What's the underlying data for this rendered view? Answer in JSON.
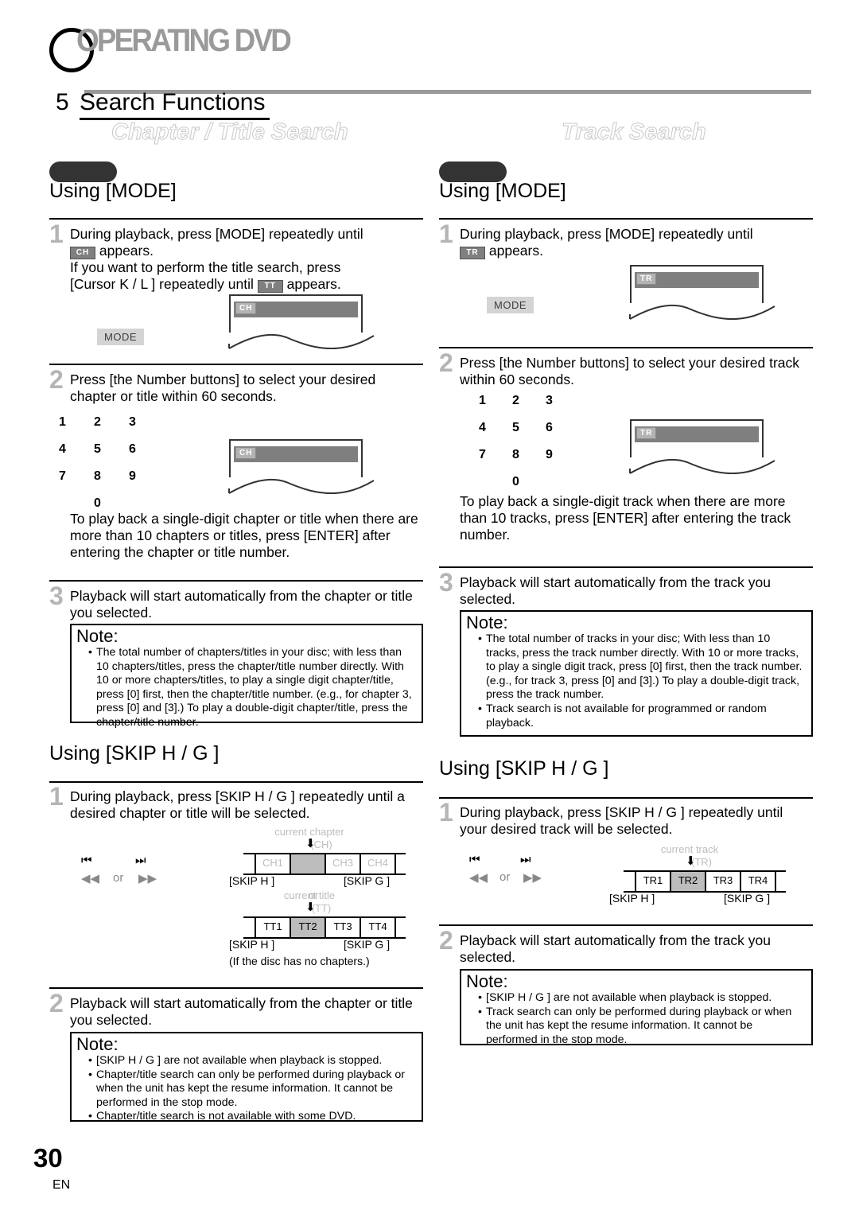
{
  "running_head": {
    "text": "OPERATING DVD",
    "drop_cap": "O"
  },
  "section": {
    "number": "5",
    "title": "Search Functions"
  },
  "columns": {
    "left": {
      "banner": "Chapter / Title Search",
      "mode_heading": "Using [MODE]",
      "skip_heading": "Using [SKIP H    / G    ]",
      "mode_steps": [
        {
          "number": "1",
          "line1": "During playback, press [MODE] repeatedly until",
          "badge1": "CH",
          "line2": "appears.",
          "line3": "If you want to perform the title search, press",
          "line4_pre": "[Cursor K / L ] repeatedly until",
          "badge2": "TT",
          "line4_post": "appears."
        },
        {
          "number": "2",
          "text": "Press [the Number buttons] to select your desired chapter or title within 60 seconds."
        },
        {
          "number": "3",
          "text": "Playback will start automatically from the chapter or title you selected."
        }
      ],
      "mode_paragraph": "To play back a single-digit chapter or title when there are more than 10 chapters or titles, press [ENTER] after entering the chapter or title number.",
      "mode_note": {
        "title": "Note:",
        "items": [
          "The total number of chapters/titles in your disc; with less than 10 chapters/titles, press the chapter/title number directly. With 10 or more chapters/titles, to play a single digit chapter/title, press [0] first, then the chapter/title number. (e.g., for chapter 3, press [0] and [3].) To play a double-digit chapter/title, press the chapter/title number."
        ]
      },
      "skip_steps": [
        {
          "number": "1",
          "text": "During playback, press [SKIP H    / G    ] repeatedly until a desired chapter or title will be selected."
        },
        {
          "number": "2",
          "text": "Playback will start automatically from the chapter or title you selected."
        }
      ],
      "skip_note": {
        "title": "Note:",
        "items": [
          "[SKIP H    / G    ] are not available when playback is stopped.",
          "Chapter/title search can only be performed during playback or when the unit has kept the resume information. It cannot be performed in the stop mode.",
          "Chapter/title search is not available with some DVD."
        ]
      },
      "panel_tag_step1": "CH",
      "panel_tag_step2": "CH",
      "mode_key_label": "MODE",
      "strip_chapter": {
        "caption_top": "current chapter",
        "caption_sub": "(CH)",
        "cells": [
          "CH1",
          "",
          "CH3",
          "CH4"
        ],
        "selected_index": 1,
        "skip_prev": "[SKIP H    ]",
        "skip_next": "[SKIP G    ]",
        "or": "or"
      },
      "strip_title": {
        "caption_top": "current title",
        "caption_sub": "(TT)",
        "cells": [
          "TT1",
          "TT2",
          "TT3",
          "TT4"
        ],
        "selected_index": 1,
        "skip_prev": "[SKIP H    ]",
        "skip_next": "[SKIP G    ]",
        "footnote": "(If the disc has no chapters.)"
      }
    },
    "right": {
      "banner": "Track Search",
      "mode_heading": "Using [MODE]",
      "skip_heading": "Using [SKIP H    / G    ]",
      "mode_steps": [
        {
          "number": "1",
          "line1": "During playback, press [MODE] repeatedly until",
          "badge1": "TR",
          "line2": "appears."
        },
        {
          "number": "2",
          "text": "Press [the Number buttons] to select your desired track within 60 seconds."
        },
        {
          "number": "3",
          "text": "Playback will start automatically from the track you selected."
        }
      ],
      "mode_paragraph": "To play back a single-digit track when there are more than 10 tracks, press [ENTER] after entering the track number.",
      "mode_note": {
        "title": "Note:",
        "items": [
          "The total number of tracks in your disc; With less than 10 tracks, press the track number directly. With 10 or more tracks, to play a single digit track, press [0] first, then the track number. (e.g., for track 3, press [0] and [3].)  To play a double-digit track, press the track number.",
          "Track search is not available for programmed or random playback."
        ]
      },
      "skip_steps": [
        {
          "number": "1",
          "text": "During playback, press [SKIP H    / G    ] repeatedly until your desired track will be selected."
        },
        {
          "number": "2",
          "text": "Playback will start automatically from the track you selected."
        }
      ],
      "skip_note": {
        "title": "Note:",
        "items": [
          "[SKIP H    / G    ] are not available when playback is stopped.",
          "Track search can only be performed during playback or when the unit has kept the resume information. It cannot be performed in the stop mode."
        ]
      },
      "panel_tag_step1": "TR",
      "panel_tag_step2": "TR",
      "mode_key_label": "MODE",
      "strip_track": {
        "caption_top": "current track",
        "caption_sub": "(TR)",
        "cells": [
          "TR1",
          "TR2",
          "TR3",
          "TR4"
        ],
        "selected_index": 1,
        "skip_prev": "[SKIP H    ]",
        "skip_next": "[SKIP G    ]"
      }
    }
  },
  "keypad": {
    "rows": [
      [
        "1",
        "2",
        "3"
      ],
      [
        "4",
        "5",
        "6"
      ],
      [
        "7",
        "8",
        "9"
      ]
    ],
    "zero": "0"
  },
  "transport": {
    "prev": "⏮",
    "next": "⏭",
    "rew": "◀◀",
    "ff": "▶▶",
    "or": "or"
  },
  "footer": {
    "page_number": "30",
    "language": "EN"
  },
  "colors": {
    "banner_outline": "#c9c9c9",
    "step_number": "#b5b5b5",
    "panel_bar": "#7f7f7f",
    "badge": "#808080",
    "keycap": "#d4d4d4",
    "rule": "#9a9a9a"
  }
}
